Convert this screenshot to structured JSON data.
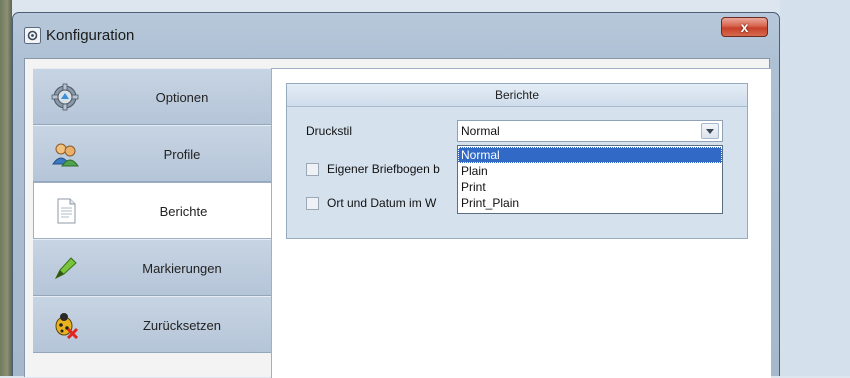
{
  "window": {
    "title": "Konfiguration",
    "close_symbol": "x"
  },
  "nav": {
    "items": [
      {
        "label": "Optionen",
        "icon": "gear-icon"
      },
      {
        "label": "Profile",
        "icon": "users-icon"
      },
      {
        "label": "Berichte",
        "icon": "document-icon"
      },
      {
        "label": "Markierungen",
        "icon": "highlighter-icon"
      },
      {
        "label": "Zurücksetzen",
        "icon": "bug-reset-icon"
      }
    ],
    "active": "Berichte"
  },
  "reports": {
    "group_title": "Berichte",
    "druckstil_label": "Druckstil",
    "druckstil_value": "Normal",
    "options": [
      "Normal",
      "Plain",
      "Print",
      "Print_Plain"
    ],
    "checkbox1_label": "Eigener Briefbogen b",
    "checkbox2_label": "Ort und Datum im W"
  },
  "colors": {
    "window_frame": "#aec0d4",
    "selection": "#3069c6",
    "close_button": "#d8634c"
  }
}
